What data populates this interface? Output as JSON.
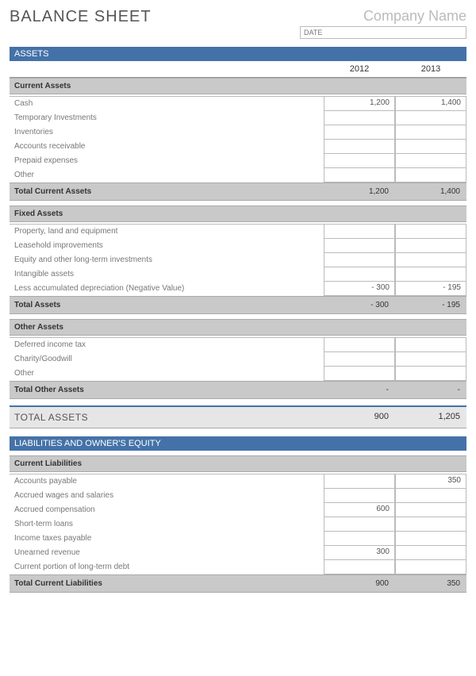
{
  "header": {
    "title": "BALANCE SHEET",
    "company_placeholder": "Company Name",
    "date_placeholder": "DATE"
  },
  "years": {
    "y1": "2012",
    "y2": "2013"
  },
  "sections": {
    "assets": {
      "title": "ASSETS",
      "current": {
        "title": "Current Assets",
        "rows": [
          {
            "label": "Cash",
            "y1": "1,200",
            "y2": "1,400"
          },
          {
            "label": "Temporary Investments",
            "y1": "",
            "y2": ""
          },
          {
            "label": "Inventories",
            "y1": "",
            "y2": ""
          },
          {
            "label": "Accounts receivable",
            "y1": "",
            "y2": ""
          },
          {
            "label": "Prepaid expenses",
            "y1": "",
            "y2": ""
          },
          {
            "label": "Other",
            "y1": "",
            "y2": ""
          }
        ],
        "total": {
          "label": "Total Current Assets",
          "y1": "1,200",
          "y2": "1,400"
        }
      },
      "fixed": {
        "title": "Fixed Assets",
        "rows": [
          {
            "label": "Property, land and equipment",
            "y1": "",
            "y2": ""
          },
          {
            "label": "Leasehold improvements",
            "y1": "",
            "y2": ""
          },
          {
            "label": "Equity and other long-term investments",
            "y1": "",
            "y2": ""
          },
          {
            "label": "Intangible assets",
            "y1": "",
            "y2": ""
          },
          {
            "label": "Less accumulated depreciation (Negative Value)",
            "y1": "- 300",
            "y2": "- 195"
          }
        ],
        "total": {
          "label": "Total Assets",
          "y1": "- 300",
          "y2": "- 195"
        }
      },
      "other": {
        "title": "Other Assets",
        "rows": [
          {
            "label": "Deferred income tax",
            "y1": "",
            "y2": ""
          },
          {
            "label": "Charity/Goodwill",
            "y1": "",
            "y2": ""
          },
          {
            "label": "Other",
            "y1": "",
            "y2": ""
          }
        ],
        "total": {
          "label": "Total Other Assets",
          "y1": "-",
          "y2": "-"
        }
      },
      "grand": {
        "label": "TOTAL ASSETS",
        "y1": "900",
        "y2": "1,205"
      }
    },
    "liabilities": {
      "title": "LIABILITIES AND OWNER'S EQUITY",
      "current": {
        "title": "Current Liabilities",
        "rows": [
          {
            "label": "Accounts payable",
            "y1": "",
            "y2": "350"
          },
          {
            "label": "Accrued wages and salaries",
            "y1": "",
            "y2": ""
          },
          {
            "label": "Accrued compensation",
            "y1": "600",
            "y2": ""
          },
          {
            "label": "Short-term loans",
            "y1": "",
            "y2": ""
          },
          {
            "label": "Income taxes payable",
            "y1": "",
            "y2": ""
          },
          {
            "label": "Unearned revenue",
            "y1": "300",
            "y2": ""
          },
          {
            "label": "Current portion of long-term debt",
            "y1": "",
            "y2": ""
          }
        ],
        "total": {
          "label": "Total Current Liabilities",
          "y1": "900",
          "y2": "350"
        }
      }
    }
  }
}
